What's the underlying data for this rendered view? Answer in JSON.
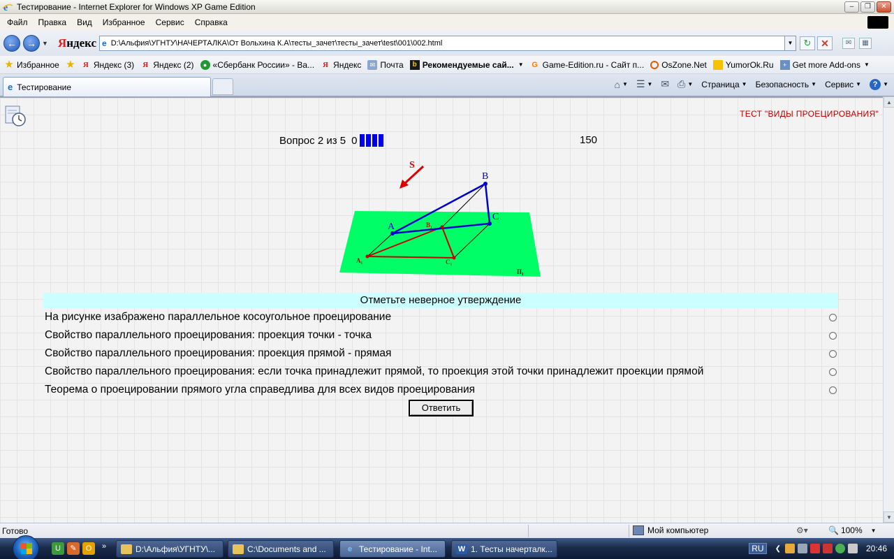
{
  "window": {
    "title": "Тестирование - Internet Explorer for Windows XP Game Edition",
    "buttons": {
      "minimize": "–",
      "maximize": "❐",
      "close": "✕"
    }
  },
  "menu": [
    "Файл",
    "Правка",
    "Вид",
    "Избранное",
    "Сервис",
    "Справка"
  ],
  "address": {
    "brand_first": "Я",
    "brand_rest": "ндекс",
    "url": "D:\\Альфия\\УГНТУ\\НАЧЕРТАЛКА\\От Вольхина К.А\\тесты_зачет\\тесты_зачет\\test\\001\\002.html"
  },
  "favorites": {
    "favorites_label": "Избранное",
    "items": [
      {
        "label": "Яндекс (3)",
        "icon": "yandex-icon"
      },
      {
        "label": "Яндекс (2)",
        "icon": "yandex-icon"
      },
      {
        "label": "«Сбербанк России» - Ва...",
        "icon": "sberbank-icon"
      },
      {
        "label": "Яндекс",
        "icon": "yandex-icon"
      },
      {
        "label": "Почта",
        "icon": "mail-icon"
      },
      {
        "label": "Рекомендуемые сай...",
        "icon": "bing-icon"
      },
      {
        "label": "Game-Edition.ru - Сайт п...",
        "icon": "game-edition-icon"
      },
      {
        "label": "OsZone.Net",
        "icon": "oszone-icon"
      },
      {
        "label": "YumorOk.Ru",
        "icon": "yumorok-icon"
      },
      {
        "label": "Get more Add-ons",
        "icon": "addons-icon"
      }
    ]
  },
  "tabs": {
    "active": "Тестирование"
  },
  "commands": {
    "page": "Страница",
    "safety": "Безопасность",
    "tools": "Сервис"
  },
  "quiz": {
    "test_title": "ТЕСТ \"ВИДЫ ПРОЕЦИРОВАНИЯ\"",
    "question_label": "Вопрос 2 из 5",
    "score": "0",
    "progress_bars": 4,
    "timer": "150",
    "figure": {
      "labels": {
        "S": "S",
        "A": "A",
        "B": "B",
        "C": "C",
        "A1": "A₁",
        "B1": "B₁",
        "C1": "C₁",
        "Pi1": "П₁"
      },
      "colors": {
        "plane": "#00ff66",
        "original": "#0000cc",
        "projection": "#cc0000",
        "arrow": "#dd0000"
      }
    },
    "prompt": "Отметьте неверное утверждение",
    "answers": [
      "На рисунке изабражено параллельное косоугольное проецирование",
      "Свойство параллельного проецирования: проекция точки - точка",
      "Свойство параллельного проецирования: проекция прямой - прямая",
      "Свойство параллельного проецирования: если точка принадлежит прямой, то проекция этой точки принадлежит проекции прямой",
      "Теорема о проецировании прямого угла справедлива для всех видов проецирования"
    ],
    "submit_label": "Ответить"
  },
  "status": {
    "text": "Готово",
    "zone": "Мой компьютер",
    "zoom": "100%"
  },
  "taskbar": {
    "tasks": [
      {
        "label": "D:\\Альфия\\УГНТУ\\...",
        "icon": "folder-icon"
      },
      {
        "label": "C:\\Documents and ...",
        "icon": "folder-icon"
      },
      {
        "label": "Тестирование - Int...",
        "icon": "ie-icon"
      },
      {
        "label": "1. Тесты начерталк...",
        "icon": "word-icon"
      }
    ],
    "lang": "RU",
    "clock": "20:46"
  }
}
